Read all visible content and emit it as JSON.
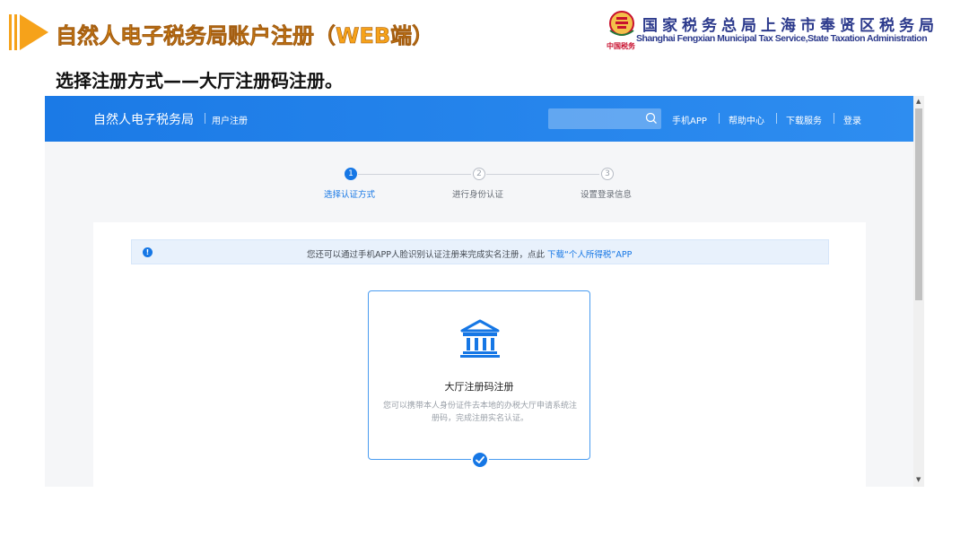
{
  "slide": {
    "title": "自然人电子税务局账户注册（WEB端）",
    "subtitle": "选择注册方式——大厅注册码注册。",
    "logo": {
      "org_cn": "国家税务总局上海市奉贤区税务局",
      "org_en": "Shanghai Fengxian Municipal Tax Service,State Taxation Administration",
      "emblem_text": "中国税务"
    }
  },
  "app": {
    "brand": "自然人电子税务局",
    "brand_sub": "用户注册",
    "search": {
      "placeholder": ""
    },
    "nav": [
      "手机APP",
      "帮助中心",
      "下载服务",
      "登录"
    ],
    "colors": {
      "primary": "#1677e5",
      "header": "#1b7ae6"
    }
  },
  "steps": [
    {
      "number": "1",
      "label": "选择认证方式",
      "state": "active"
    },
    {
      "number": "2",
      "label": "进行身份认证",
      "state": "idle"
    },
    {
      "number": "3",
      "label": "设置登录信息",
      "state": "idle"
    }
  ],
  "notice": {
    "icon": "info-icon",
    "text": "您还可以通过手机APP人脸识别认证注册来完成实名注册，点此",
    "link_text": "下载“个人所得税”APP"
  },
  "option_card": {
    "icon": "bank-building-icon",
    "title": "大厅注册码注册",
    "description": "您可以携带本人身份证件去本地的办税大厅申请系统注册码，完成注册实名认证。",
    "selected": true
  }
}
